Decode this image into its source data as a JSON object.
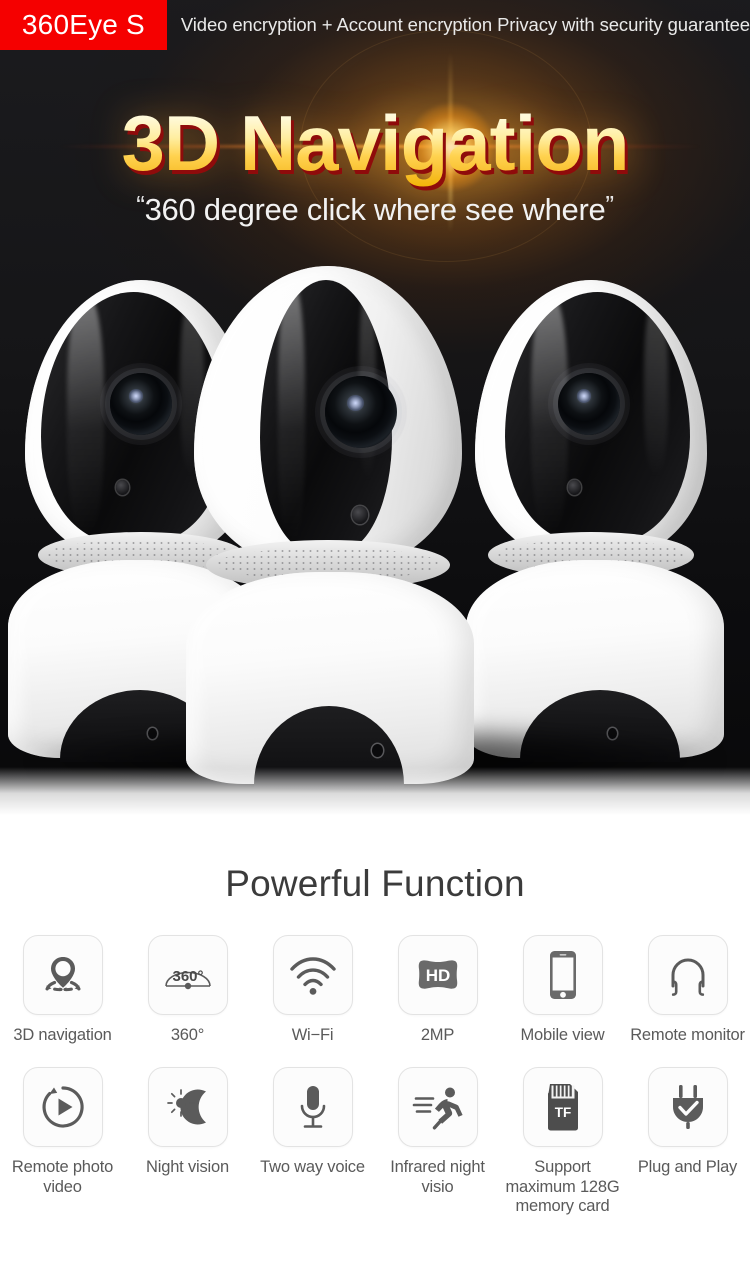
{
  "topbar": {
    "brand": "360Eye S",
    "tagline": "Video encryption + Account encryption  Privacy with security guarantee",
    "brand_bg": "#f50000",
    "brand_text_color": "#ffffff"
  },
  "hero": {
    "title": "3D Navigation",
    "subtitle_open_quote": "“",
    "subtitle": "360 degree click where see where",
    "subtitle_close_quote": "”",
    "title_gradient_top": "#fffdf2",
    "title_gradient_bottom": "#f2b300",
    "title_shadow": "#8f0b0b",
    "background": "#17171a",
    "product_alt": "three white dome wifi ip cameras"
  },
  "features": {
    "heading": "Powerful Function",
    "rows": [
      [
        {
          "icon": "3d-navigation-icon",
          "label": "3D navigation"
        },
        {
          "icon": "360-degree-icon",
          "label": "360°",
          "icon_text": "360°"
        },
        {
          "icon": "wifi-icon",
          "label": "Wi−Fi"
        },
        {
          "icon": "hd-icon",
          "label": "2MP",
          "icon_text": "HD"
        },
        {
          "icon": "mobile-phone-icon",
          "label": "Mobile view"
        },
        {
          "icon": "headphone-icon",
          "label": "Remote monitor"
        }
      ],
      [
        {
          "icon": "play-circle-icon",
          "label": "Remote photo video"
        },
        {
          "icon": "night-vision-icon",
          "label": "Night vision"
        },
        {
          "icon": "microphone-icon",
          "label": "Two way voice"
        },
        {
          "icon": "running-person-icon",
          "label": "Infrared night visio"
        },
        {
          "icon": "tf-card-icon",
          "label": "Support maximum 128G memory card",
          "icon_text": "TF"
        },
        {
          "icon": "power-plug-check-icon",
          "label": "Plug and Play"
        }
      ]
    ],
    "icon_color": "#5b5b5b",
    "label_color": "#5a5a5a",
    "tile_border": "#e3e3e3"
  }
}
